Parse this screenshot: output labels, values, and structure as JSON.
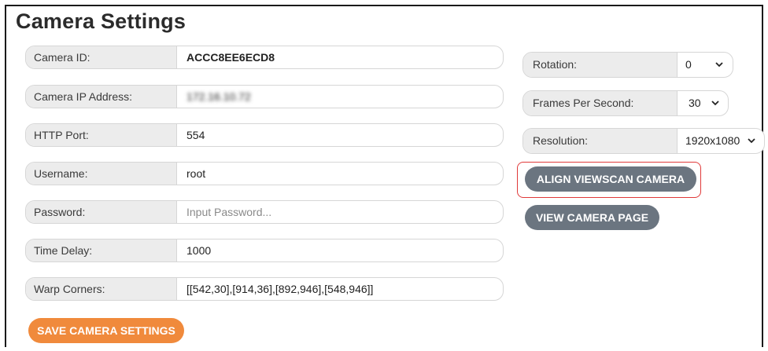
{
  "page": {
    "title": "Camera Settings"
  },
  "fields": [
    {
      "label": "Camera ID:",
      "value": "ACCC8EE6ECD8"
    },
    {
      "label": "Camera IP Address:",
      "value": "172.16.10.72"
    },
    {
      "label": "HTTP Port:",
      "value": "554"
    },
    {
      "label": "Username:",
      "value": "root"
    },
    {
      "label": "Password:",
      "value": "",
      "placeholder": "Input Password..."
    },
    {
      "label": "Time Delay:",
      "value": "1000"
    },
    {
      "label": "Warp Corners:",
      "value": "[[542,30],[914,36],[892,946],[548,946]]"
    }
  ],
  "selects": {
    "rotation": {
      "label": "Rotation:",
      "value": "0"
    },
    "fps": {
      "label": "Frames Per Second:",
      "value": "30"
    },
    "resolution": {
      "label": "Resolution:",
      "value": "1920x1080"
    }
  },
  "buttons": {
    "align": "ALIGN VIEWSCAN CAMERA",
    "view": "VIEW CAMERA PAGE",
    "save": "SAVE CAMERA SETTINGS"
  },
  "colors": {
    "save_button": "#f08a3c",
    "secondary_button": "#6b7580",
    "highlight_border": "#e03a3a"
  }
}
